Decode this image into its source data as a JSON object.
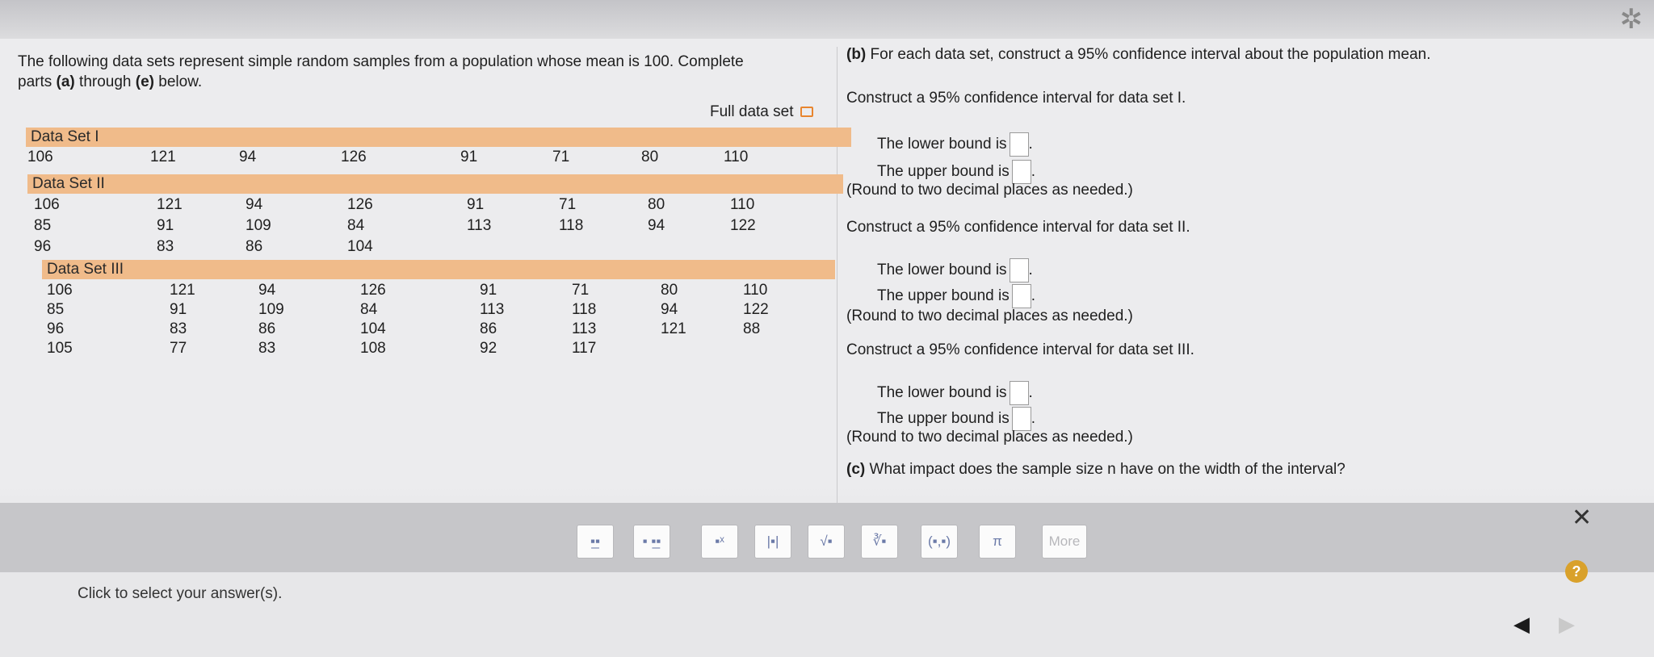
{
  "intro": {
    "line1": "The following data sets represent simple random samples from a population whose mean is 100. Complete",
    "line2_pre": "parts ",
    "line2_a": "(a)",
    "line2_mid": " through ",
    "line2_e": "(e)",
    "line2_post": " below."
  },
  "full_data_set": "Full data set",
  "datasets": [
    {
      "name": "Data Set I",
      "rows": [
        [
          "106",
          "121",
          "94",
          "126",
          "91",
          "71",
          "80",
          "110"
        ]
      ]
    },
    {
      "name": "Data Set II",
      "rows": [
        [
          "106",
          "121",
          "94",
          "126",
          "91",
          "71",
          "80",
          "110"
        ],
        [
          "85",
          "91",
          "109",
          "84",
          "113",
          "118",
          "94",
          "122"
        ],
        [
          "96",
          "83",
          "86",
          "104"
        ]
      ]
    },
    {
      "name": "Data Set III",
      "rows": [
        [
          "106",
          "121",
          "94",
          "126",
          "91",
          "71",
          "80",
          "110"
        ],
        [
          "85",
          "91",
          "109",
          "84",
          "113",
          "118",
          "94",
          "122"
        ],
        [
          "96",
          "83",
          "86",
          "104",
          "86",
          "113",
          "121",
          "88"
        ],
        [
          "105",
          "77",
          "83",
          "108",
          "92",
          "117"
        ]
      ]
    }
  ],
  "part_b": {
    "label": "(b)",
    "prompt": "For each data set, construct a 95% confidence interval about the population mean.",
    "sets": [
      {
        "construct": "Construct a 95% confidence interval for data set I.",
        "lower": "The lower bound is",
        "upper": "The upper bound is",
        "round": "(Round to two decimal places as needed.)"
      },
      {
        "construct": "Construct a 95% confidence interval for data set II.",
        "lower": "The lower bound is",
        "upper": "The upper bound is",
        "round": "(Round to two decimal places as needed.)"
      },
      {
        "construct": "Construct a 95% confidence interval for data set III.",
        "lower": "The lower bound is",
        "upper": "The upper bound is",
        "round": "(Round to two decimal places as needed.)"
      }
    ]
  },
  "part_c": {
    "label": "(c)",
    "prompt": "What impact does the sample size n have on the width of the interval?"
  },
  "toolbar": {
    "buttons": [
      "fraction-icon",
      "mixed-number-icon",
      "exponent-icon",
      "absolute-value-icon",
      "square-root-icon",
      "nth-root-icon",
      "ordered-pair-icon",
      "pi-icon"
    ],
    "glyphs": [
      "▪̲▪",
      "▪ ▪̲▪",
      "▪ˣ",
      "|▪|",
      "√▪",
      "∛▪",
      "(▪,▪)",
      "π"
    ],
    "more": "More"
  },
  "status": "Click to select your answer(s).",
  "help": "?"
}
